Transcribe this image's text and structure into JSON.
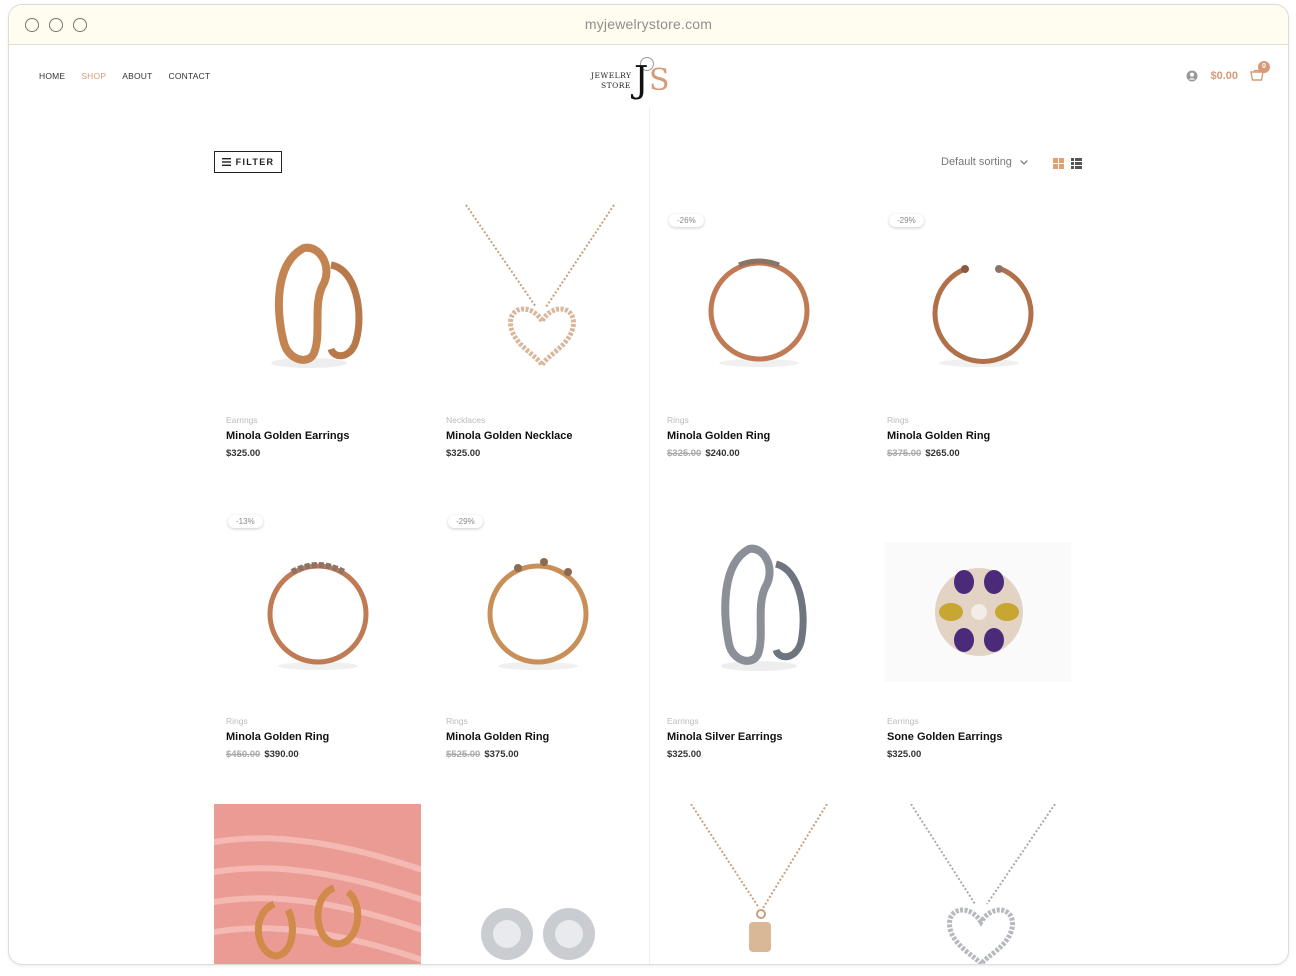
{
  "browser": {
    "url": "myjewelrystore.com"
  },
  "nav": {
    "items": [
      "HOME",
      "SHOP",
      "ABOUT",
      "CONTACT"
    ],
    "active_index": 1
  },
  "logo": {
    "line1": "JEWELRY",
    "line2": "STORE",
    "letter1": "J",
    "letter2": "S"
  },
  "header": {
    "cart_total": "$0.00",
    "cart_count": "0",
    "user_icon": "user-icon",
    "cart_icon": "cart-icon"
  },
  "shop": {
    "filter_label": "FILTER",
    "sorting_label": "Default sorting"
  },
  "colors": {
    "accent": "#d69a78",
    "text": "#111111",
    "muted": "#bbbbbb"
  },
  "products": [
    {
      "category": "Earrings",
      "name": "Minola Golden Earrings",
      "price": "$325.00",
      "old_price": "",
      "discount": ""
    },
    {
      "category": "Necklaces",
      "name": "Minola Golden Necklace",
      "price": "$325.00",
      "old_price": "",
      "discount": ""
    },
    {
      "category": "Rings",
      "name": "Minola Golden Ring",
      "price": "$240.00",
      "old_price": "$325.00",
      "discount": "-26%"
    },
    {
      "category": "Rings",
      "name": "Minola Golden Ring",
      "price": "$265.00",
      "old_price": "$375.00",
      "discount": "-29%"
    },
    {
      "category": "Rings",
      "name": "Minola Golden Ring",
      "price": "$390.00",
      "old_price": "$450.00",
      "discount": "-13%"
    },
    {
      "category": "Rings",
      "name": "Minola Golden Ring",
      "price": "$375.00",
      "old_price": "$525.00",
      "discount": "-29%"
    },
    {
      "category": "Earrings",
      "name": "Minola Silver Earrings",
      "price": "$325.00",
      "old_price": "",
      "discount": ""
    },
    {
      "category": "Earrings",
      "name": "Sone Golden Earrings",
      "price": "$325.00",
      "old_price": "",
      "discount": ""
    }
  ]
}
